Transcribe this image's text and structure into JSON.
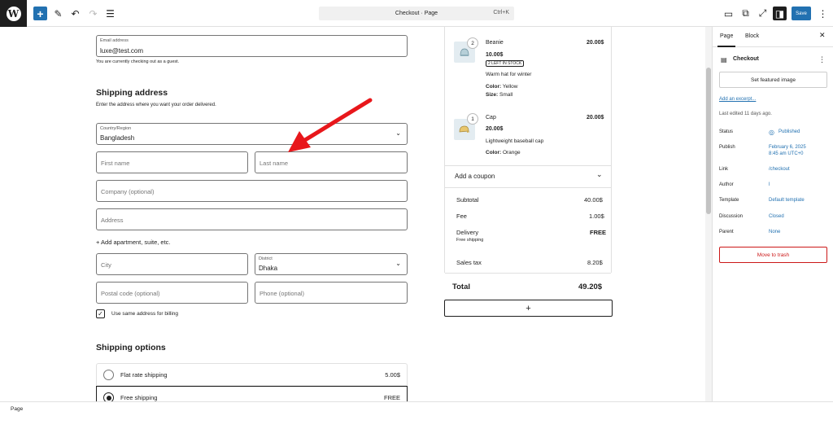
{
  "toolbar": {
    "search_text": "Checkout · Page",
    "shortcut": "Ctrl+K",
    "save_label": "Save"
  },
  "contact": {
    "email_label": "Email address",
    "email_value": "luxe@test.com",
    "guest_note": "You are currently checking out as a guest."
  },
  "shipping": {
    "heading": "Shipping address",
    "description": "Enter the address where you want your order delivered.",
    "country_label": "Country/Region",
    "country_value": "Bangladesh",
    "first_name_placeholder": "First name",
    "last_name_placeholder": "Last name",
    "company_placeholder": "Company (optional)",
    "address_placeholder": "Address",
    "add_apartment": "+ Add apartment, suite, etc.",
    "city_placeholder": "City",
    "district_label": "District",
    "district_value": "Dhaka",
    "postal_placeholder": "Postal code (optional)",
    "phone_placeholder": "Phone (optional)",
    "same_billing_label": "Use same address for billing"
  },
  "shipping_options": {
    "heading": "Shipping options",
    "options": [
      {
        "label": "Flat rate shipping",
        "price": "5.00$"
      },
      {
        "label": "Free shipping",
        "price": "FREE"
      }
    ]
  },
  "order": {
    "items": [
      {
        "qty": "2",
        "name": "Beanie",
        "total": "20.00$",
        "price": "10.00$",
        "stock": "2 LEFT IN STOCK",
        "desc": "Warm hat for winter",
        "color_label": "Color:",
        "color": "Yellow",
        "size_label": "Size:",
        "size": "Small"
      },
      {
        "qty": "1",
        "name": "Cap",
        "total": "20.00$",
        "price": "20.00$",
        "desc": "Lightweight baseball cap",
        "color_label": "Color:",
        "color": "Orange"
      }
    ],
    "coupon": "Add a coupon",
    "subtotal_label": "Subtotal",
    "subtotal": "40.00$",
    "fee_label": "Fee",
    "fee": "1.00$",
    "delivery_label": "Delivery",
    "delivery": "FREE",
    "delivery_sub": "Free shipping",
    "tax_label": "Sales tax",
    "tax": "8.20$",
    "total_label": "Total",
    "total": "49.20$",
    "add_block": "+"
  },
  "sidebar": {
    "tab_page": "Page",
    "tab_block": "Block",
    "title": "Checkout",
    "featured_image": "Set featured image",
    "excerpt_link": "Add an excerpt...",
    "last_edited": "Last edited 11 days ago.",
    "rows": [
      {
        "label": "Status",
        "value": "Published"
      },
      {
        "label": "Publish",
        "value": "February 6, 2025",
        "value2": "8:45 am UTC+0"
      },
      {
        "label": "Link",
        "value": "/checkout"
      },
      {
        "label": "Author",
        "value": "l"
      },
      {
        "label": "Template",
        "value": "Default template"
      },
      {
        "label": "Discussion",
        "value": "Closed"
      },
      {
        "label": "Parent",
        "value": "None"
      }
    ],
    "trash": "Move to trash"
  },
  "statusbar": {
    "label": "Page"
  },
  "colors": {
    "accent": "#2271b1",
    "annotation_arrow": "#e8171b",
    "trash": "#cc1818"
  }
}
